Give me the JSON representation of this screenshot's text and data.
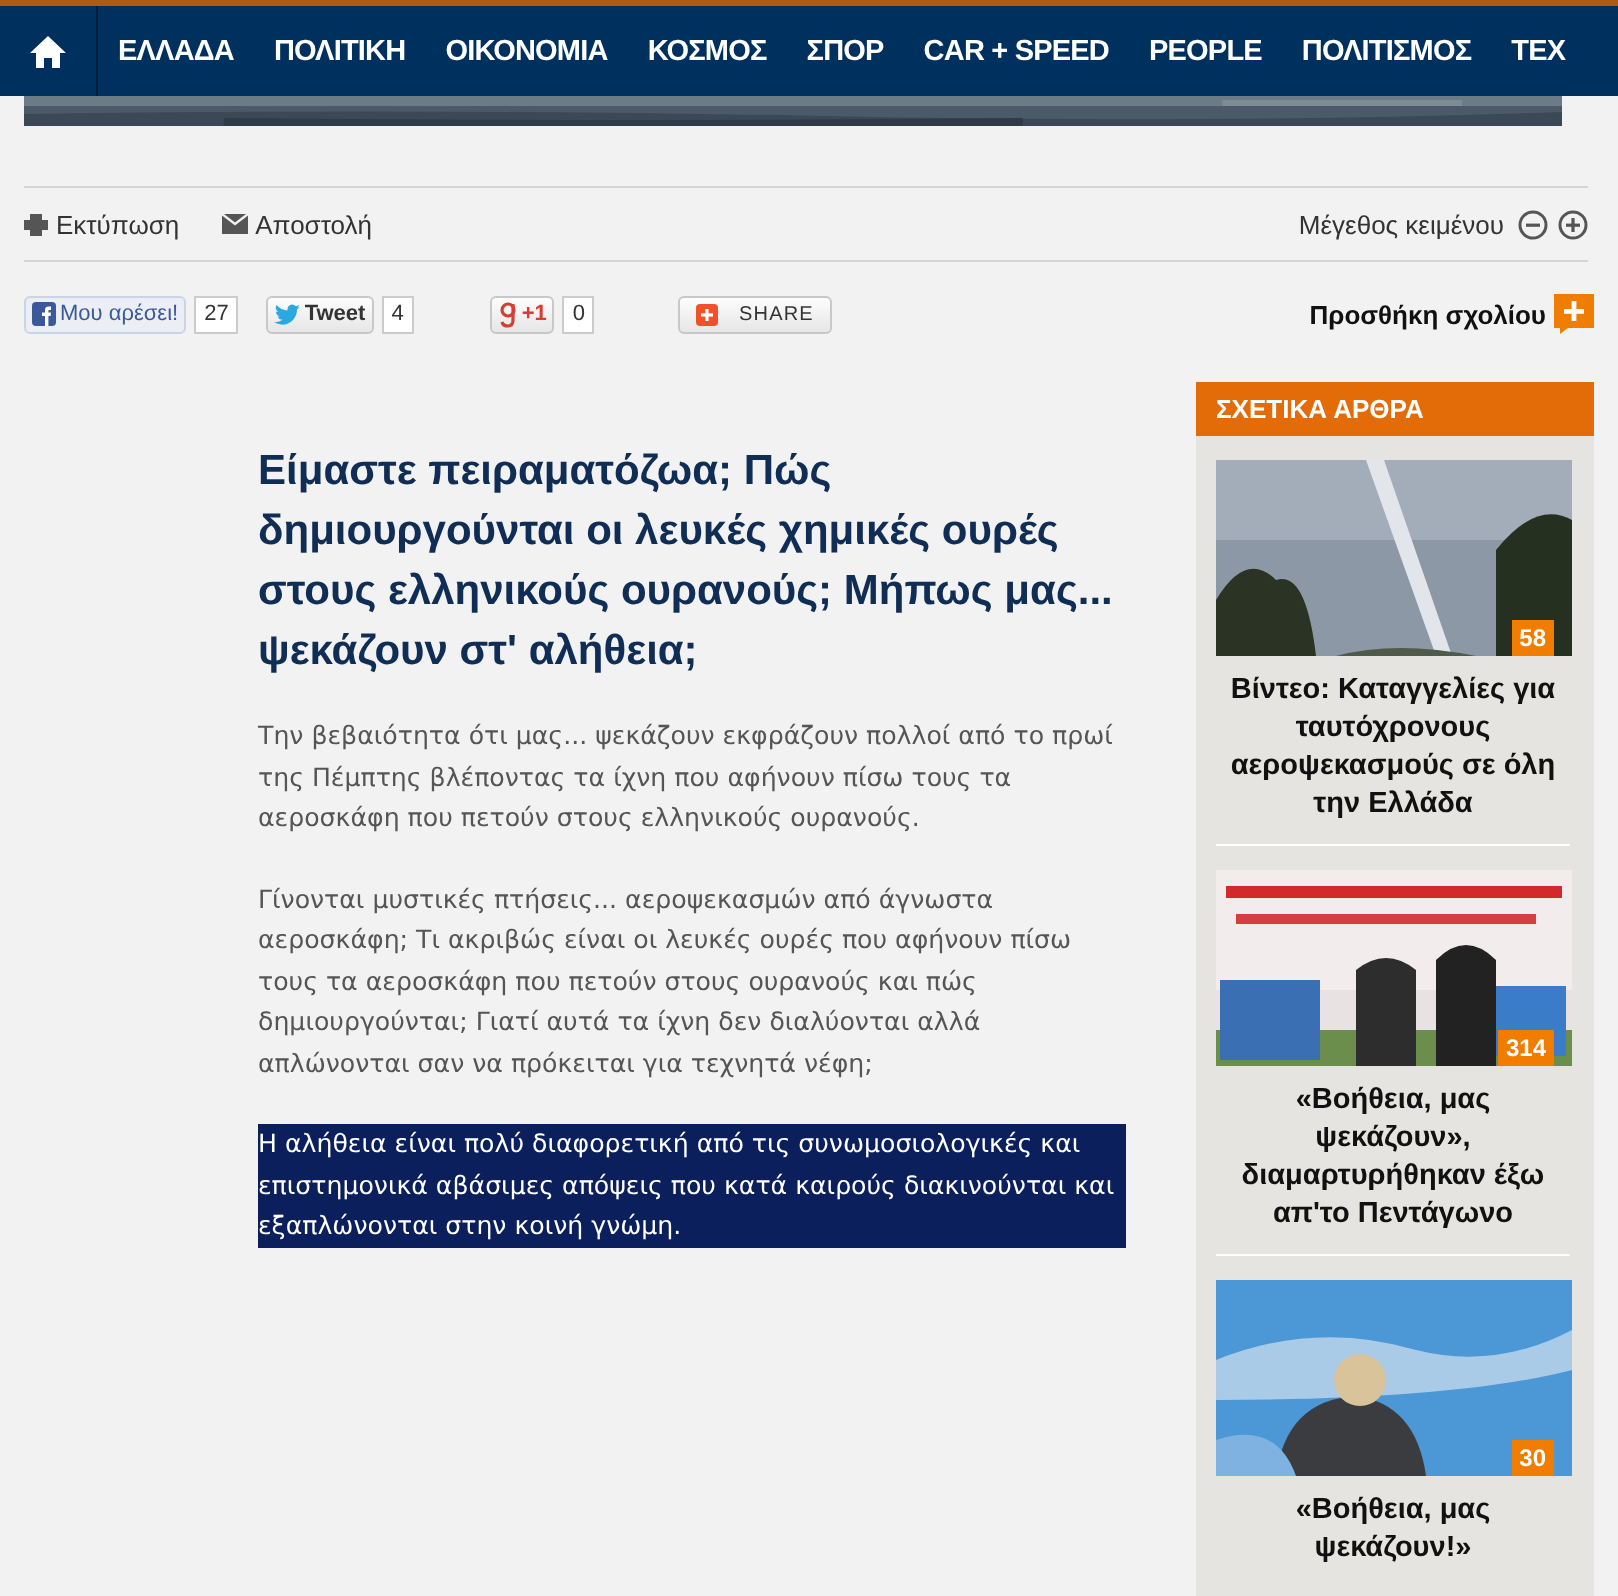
{
  "nav": {
    "items": [
      {
        "label": "ΕΛΛΑΔΑ"
      },
      {
        "label": "ΠΟΛΙΤΙΚΗ"
      },
      {
        "label": "ΟΙΚΟΝΟΜΙΑ"
      },
      {
        "label": "ΚΟΣΜΟΣ"
      },
      {
        "label": "ΣΠΟΡ"
      },
      {
        "label": "CAR + SPEED"
      },
      {
        "label": "PEOPLE"
      },
      {
        "label": "ΠΟΛΙΤΙΣΜΟΣ"
      },
      {
        "label": "ΤΕΧ"
      }
    ]
  },
  "toolbar": {
    "print": "Εκτύπωση",
    "send": "Αποστολή",
    "text_size": "Μέγεθος κειμένου"
  },
  "social": {
    "like": {
      "label": "Μου αρέσει!",
      "count": "27"
    },
    "tweet": {
      "label": "Tweet",
      "count": "4"
    },
    "plusone": {
      "label": "+1",
      "count": "0"
    },
    "share": {
      "label": "SHARE"
    },
    "add_comment": "Προσθήκη σχολίου"
  },
  "article": {
    "title": "Είμαστε πειραματόζωα; Πώς δημιουργούνται οι λευκές χημικές ουρές στους ελληνικούς ουρανούς; Μήπως μας... ψεκάζουν στ' αλήθεια;",
    "paragraphs": [
      {
        "text": "Την βεβαιότητα ότι μας... ψεκάζουν εκφράζουν πολλοί από το πρωί της Πέμπτης βλέποντας τα ίχνη που αφήνουν πίσω τους τα αεροσκάφη που πετούν στους ελληνικούς ουρανούς.",
        "selected": false
      },
      {
        "text": "Γίνονται μυστικές πτήσεις... αεροψεκασμών από άγνωστα αεροσκάφη; Τι ακριβώς είναι οι λευκές ουρές που αφήνουν πίσω τους τα αεροσκάφη που πετούν στους ουρανούς και πώς δημιουργούνται; Γιατί αυτά τα ίχνη δεν διαλύονται αλλά απλώνονται σαν να πρόκειται για τεχνητά νέφη;",
        "selected": false
      },
      {
        "text": "Η αλήθεια είναι πολύ διαφορετική από τις συνωμοσιολογικές και επιστημονικά αβάσιμες απόψεις που κατά καιρούς διακινούνται και εξαπλώνονται στην κοινή γνώμη.",
        "selected": true
      }
    ]
  },
  "related": {
    "title": "ΣΧΕΤΙΚΑ ΑΡΘΡΑ",
    "items": [
      {
        "kind": "picture",
        "comments": "58",
        "title": "Βίντεο: Καταγγελίες για ταυτόχρονους αεροψεκασμούς σε όλη την Ελλάδα"
      },
      {
        "kind": "picture",
        "comments": "314",
        "title": "«Βοήθεια, μας ψεκάζουν», διαμαρτυρήθηκαν έξω απ'το Πεντάγωνο"
      },
      {
        "kind": "picture",
        "comments": "30",
        "title": "«Βοήθεια, μας ψεκάζουν!»"
      }
    ]
  }
}
